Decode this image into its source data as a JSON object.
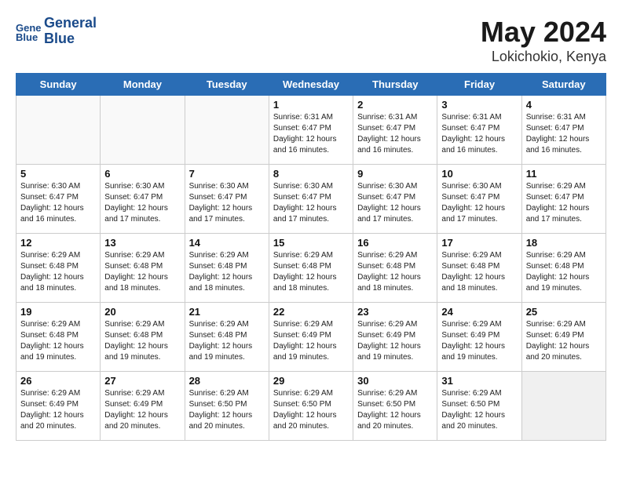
{
  "header": {
    "logo_line1": "General",
    "logo_line2": "Blue",
    "title": "May 2024",
    "subtitle": "Lokichokio, Kenya"
  },
  "weekdays": [
    "Sunday",
    "Monday",
    "Tuesday",
    "Wednesday",
    "Thursday",
    "Friday",
    "Saturday"
  ],
  "weeks": [
    [
      {
        "day": "",
        "info": ""
      },
      {
        "day": "",
        "info": ""
      },
      {
        "day": "",
        "info": ""
      },
      {
        "day": "1",
        "info": "Sunrise: 6:31 AM\nSunset: 6:47 PM\nDaylight: 12 hours\nand 16 minutes."
      },
      {
        "day": "2",
        "info": "Sunrise: 6:31 AM\nSunset: 6:47 PM\nDaylight: 12 hours\nand 16 minutes."
      },
      {
        "day": "3",
        "info": "Sunrise: 6:31 AM\nSunset: 6:47 PM\nDaylight: 12 hours\nand 16 minutes."
      },
      {
        "day": "4",
        "info": "Sunrise: 6:31 AM\nSunset: 6:47 PM\nDaylight: 12 hours\nand 16 minutes."
      }
    ],
    [
      {
        "day": "5",
        "info": "Sunrise: 6:30 AM\nSunset: 6:47 PM\nDaylight: 12 hours\nand 16 minutes."
      },
      {
        "day": "6",
        "info": "Sunrise: 6:30 AM\nSunset: 6:47 PM\nDaylight: 12 hours\nand 17 minutes."
      },
      {
        "day": "7",
        "info": "Sunrise: 6:30 AM\nSunset: 6:47 PM\nDaylight: 12 hours\nand 17 minutes."
      },
      {
        "day": "8",
        "info": "Sunrise: 6:30 AM\nSunset: 6:47 PM\nDaylight: 12 hours\nand 17 minutes."
      },
      {
        "day": "9",
        "info": "Sunrise: 6:30 AM\nSunset: 6:47 PM\nDaylight: 12 hours\nand 17 minutes."
      },
      {
        "day": "10",
        "info": "Sunrise: 6:30 AM\nSunset: 6:47 PM\nDaylight: 12 hours\nand 17 minutes."
      },
      {
        "day": "11",
        "info": "Sunrise: 6:29 AM\nSunset: 6:47 PM\nDaylight: 12 hours\nand 17 minutes."
      }
    ],
    [
      {
        "day": "12",
        "info": "Sunrise: 6:29 AM\nSunset: 6:48 PM\nDaylight: 12 hours\nand 18 minutes."
      },
      {
        "day": "13",
        "info": "Sunrise: 6:29 AM\nSunset: 6:48 PM\nDaylight: 12 hours\nand 18 minutes."
      },
      {
        "day": "14",
        "info": "Sunrise: 6:29 AM\nSunset: 6:48 PM\nDaylight: 12 hours\nand 18 minutes."
      },
      {
        "day": "15",
        "info": "Sunrise: 6:29 AM\nSunset: 6:48 PM\nDaylight: 12 hours\nand 18 minutes."
      },
      {
        "day": "16",
        "info": "Sunrise: 6:29 AM\nSunset: 6:48 PM\nDaylight: 12 hours\nand 18 minutes."
      },
      {
        "day": "17",
        "info": "Sunrise: 6:29 AM\nSunset: 6:48 PM\nDaylight: 12 hours\nand 18 minutes."
      },
      {
        "day": "18",
        "info": "Sunrise: 6:29 AM\nSunset: 6:48 PM\nDaylight: 12 hours\nand 19 minutes."
      }
    ],
    [
      {
        "day": "19",
        "info": "Sunrise: 6:29 AM\nSunset: 6:48 PM\nDaylight: 12 hours\nand 19 minutes."
      },
      {
        "day": "20",
        "info": "Sunrise: 6:29 AM\nSunset: 6:48 PM\nDaylight: 12 hours\nand 19 minutes."
      },
      {
        "day": "21",
        "info": "Sunrise: 6:29 AM\nSunset: 6:48 PM\nDaylight: 12 hours\nand 19 minutes."
      },
      {
        "day": "22",
        "info": "Sunrise: 6:29 AM\nSunset: 6:49 PM\nDaylight: 12 hours\nand 19 minutes."
      },
      {
        "day": "23",
        "info": "Sunrise: 6:29 AM\nSunset: 6:49 PM\nDaylight: 12 hours\nand 19 minutes."
      },
      {
        "day": "24",
        "info": "Sunrise: 6:29 AM\nSunset: 6:49 PM\nDaylight: 12 hours\nand 19 minutes."
      },
      {
        "day": "25",
        "info": "Sunrise: 6:29 AM\nSunset: 6:49 PM\nDaylight: 12 hours\nand 20 minutes."
      }
    ],
    [
      {
        "day": "26",
        "info": "Sunrise: 6:29 AM\nSunset: 6:49 PM\nDaylight: 12 hours\nand 20 minutes."
      },
      {
        "day": "27",
        "info": "Sunrise: 6:29 AM\nSunset: 6:49 PM\nDaylight: 12 hours\nand 20 minutes."
      },
      {
        "day": "28",
        "info": "Sunrise: 6:29 AM\nSunset: 6:50 PM\nDaylight: 12 hours\nand 20 minutes."
      },
      {
        "day": "29",
        "info": "Sunrise: 6:29 AM\nSunset: 6:50 PM\nDaylight: 12 hours\nand 20 minutes."
      },
      {
        "day": "30",
        "info": "Sunrise: 6:29 AM\nSunset: 6:50 PM\nDaylight: 12 hours\nand 20 minutes."
      },
      {
        "day": "31",
        "info": "Sunrise: 6:29 AM\nSunset: 6:50 PM\nDaylight: 12 hours\nand 20 minutes."
      },
      {
        "day": "",
        "info": ""
      }
    ]
  ]
}
